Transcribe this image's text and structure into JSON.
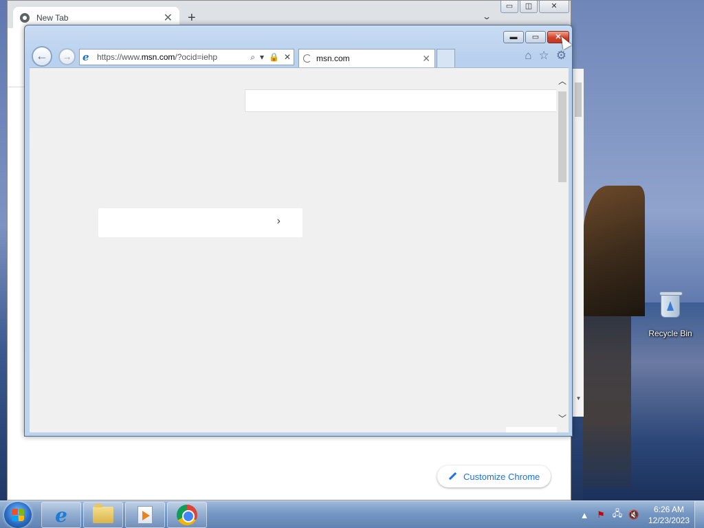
{
  "desktop": {
    "recycle_bin_label": "Recycle Bin"
  },
  "chrome": {
    "tab_title": "New Tab",
    "tab_close": "✕",
    "new_tab": "+",
    "tab_menu": "⌄",
    "controls": {
      "minimize": "▭",
      "maximize": "◫",
      "close": "✕"
    },
    "customize_label": "Customize Chrome",
    "scroll_down": "▼"
  },
  "ie": {
    "controls": {
      "minimize": "▬",
      "maximize": "▭",
      "close": "✕"
    },
    "back": "←",
    "forward": "→",
    "url_prefix": "https://www.",
    "url_domain": "msn.com",
    "url_suffix": "/?ocid=iehp",
    "addr_search": "⌕",
    "addr_dropdown": "▾",
    "addr_lock": "🔒",
    "addr_stop": "✕",
    "tab_title": "msn.com",
    "tab_close": "✕",
    "home": "⌂",
    "favorites": "☆",
    "tools": "⚙",
    "link_card_chevron": "›",
    "scroll_up": "︿",
    "scroll_down": "﹀"
  },
  "taskbar": {
    "pinned": [
      "internet-explorer",
      "windows-explorer",
      "media-player",
      "google-chrome"
    ],
    "tray": {
      "show_hidden": "▲",
      "action_center": "⚑",
      "network": "🖧",
      "volume": "🔇"
    },
    "clock_time": "6:26 AM",
    "clock_date": "12/23/2023"
  },
  "colors": {
    "ie_close_red": "#c13b21",
    "chrome_accent": "#1a73e8"
  }
}
